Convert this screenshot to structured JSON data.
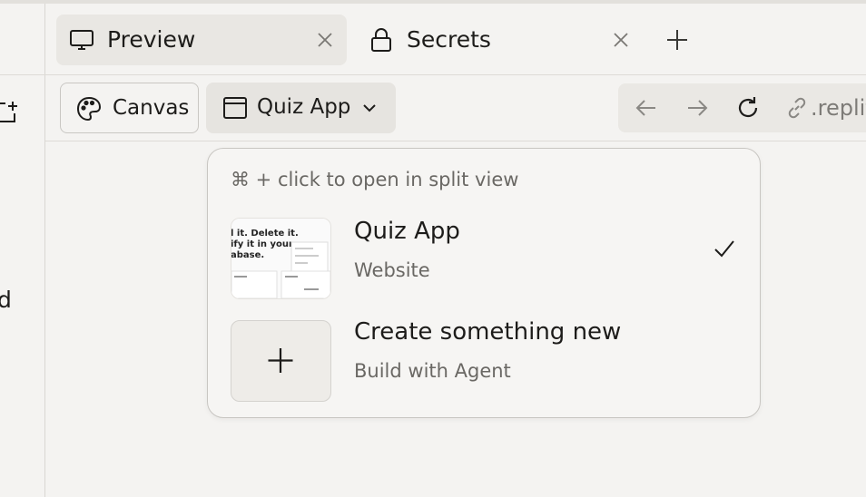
{
  "tabs": [
    {
      "label": "Preview",
      "icon": "monitor-icon",
      "active": true
    },
    {
      "label": "Secrets",
      "icon": "lock-icon",
      "active": false
    }
  ],
  "left_panel": {
    "partial_text": "d"
  },
  "toolbar": {
    "canvas_label": "Canvas",
    "app_selector_label": "Quiz App",
    "url_text": ".replit.dev"
  },
  "dropdown": {
    "hint": "⌘ + click to open in split view",
    "items": [
      {
        "title": "Quiz App",
        "subtitle": "Website",
        "selected": true
      },
      {
        "title": "Create something new",
        "subtitle": "Build with Agent",
        "selected": false
      }
    ],
    "thumbnail_text": [
      "l it. Delete it.",
      "ify it in your",
      "abase."
    ]
  },
  "colors": {
    "background": "#f4f3f1",
    "active_tab": "#e9e7e3",
    "muted_text": "#6a6864"
  }
}
